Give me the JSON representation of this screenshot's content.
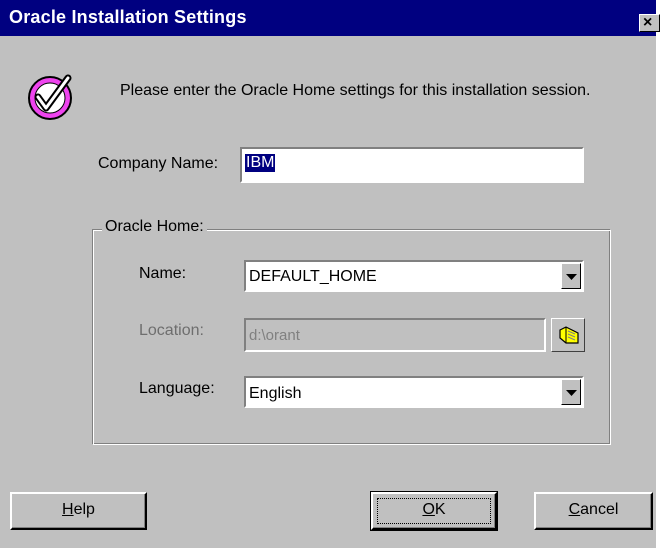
{
  "window": {
    "title": "Oracle Installation Settings",
    "close_label": "×"
  },
  "intro": {
    "text": "Please enter the Oracle Home settings for this installation session."
  },
  "company": {
    "label": "Company Name:",
    "value": "IBM"
  },
  "oracle_home": {
    "group_label": "Oracle Home:",
    "name_label": "Name:",
    "name_value": "DEFAULT_HOME",
    "location_label": "Location:",
    "location_value": "d:\\orant",
    "language_label": "Language:",
    "language_value": "English"
  },
  "buttons": {
    "help_mnemonic": "H",
    "help_rest": "elp",
    "ok_mnemonic": "O",
    "ok_rest": "K",
    "cancel_mnemonic": "C",
    "cancel_rest": "ancel"
  },
  "icons": {
    "check": "check-circle-icon",
    "browse": "folder-browse-icon",
    "dropdown": "chevron-down-icon"
  },
  "colors": {
    "titlebar": "#000080",
    "face": "#c0c0c0",
    "check_icon": "#ee44ee"
  }
}
